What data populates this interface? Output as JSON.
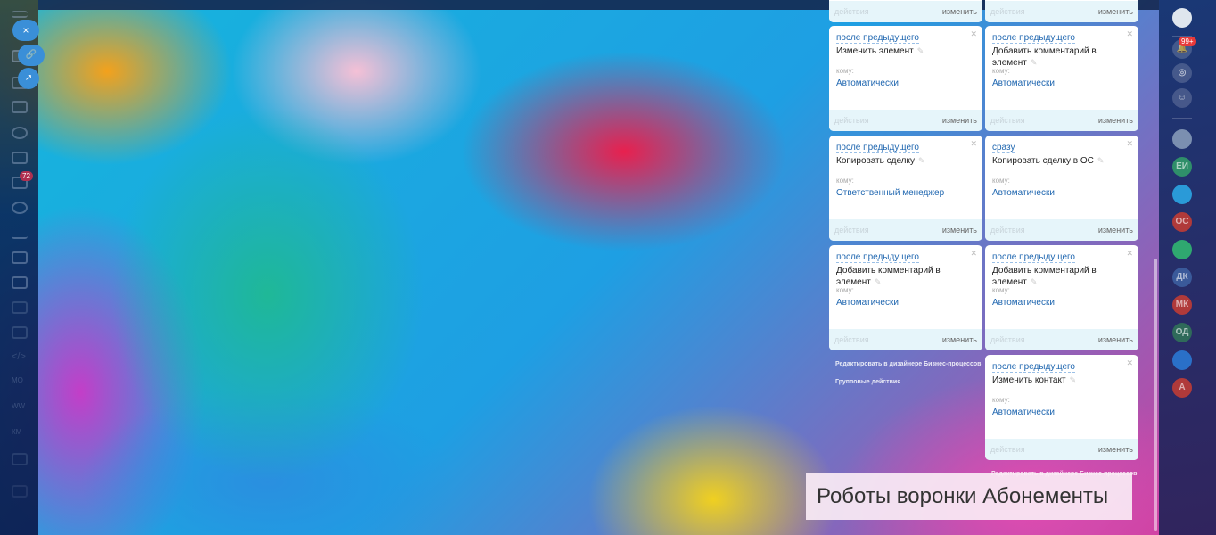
{
  "left_sidebar": {
    "tasks_badge": "72",
    "avatars": [
      "МО",
      "WW",
      "КМ"
    ]
  },
  "slider_buttons": {
    "close": "×",
    "link": "🔗",
    "open": "↗"
  },
  "right_sidebar": {
    "notifications_badge": "99+",
    "avatars": [
      {
        "label": "",
        "color": "#7b8fb0"
      },
      {
        "label": "ЕИ",
        "color": "#2f8f6a"
      },
      {
        "label": "",
        "color": "#2a9ad8"
      },
      {
        "label": "ОС",
        "color": "#b03a3a"
      },
      {
        "label": "",
        "color": "#2fa870"
      },
      {
        "label": "ДК",
        "color": "#3a5a9a"
      },
      {
        "label": "МК",
        "color": "#b03a3a"
      },
      {
        "label": "ОД",
        "color": "#2f6a5a"
      },
      {
        "label": "",
        "color": "#2a70c8"
      },
      {
        "label": "А",
        "color": "#b03a3a"
      }
    ]
  },
  "cards": [
    {
      "col": 0,
      "row": 1,
      "delay": "после предыдущего",
      "title": "Изменить элемент",
      "to": "кому:",
      "who": "Автоматически"
    },
    {
      "col": 1,
      "row": 1,
      "delay": "после предыдущего",
      "title": "Добавить комментарий в элемент",
      "to": "кому:",
      "who": "Автоматически"
    },
    {
      "col": 0,
      "row": 2,
      "delay": "после предыдущего",
      "title": "Копировать сделку",
      "to": "кому:",
      "who": "Ответственный менеджер"
    },
    {
      "col": 1,
      "row": 2,
      "delay": "сразу",
      "title": "Копировать сделку в ОС",
      "to": "кому:",
      "who": "Автоматически"
    },
    {
      "col": 0,
      "row": 3,
      "delay": "после предыдущего",
      "title": "Добавить комментарий в элемент",
      "to": "кому:",
      "who": "Автоматически"
    },
    {
      "col": 1,
      "row": 3,
      "delay": "после предыдущего",
      "title": "Добавить комментарий в элемент",
      "to": "кому:",
      "who": "Автоматически"
    },
    {
      "col": 1,
      "row": 4,
      "delay": "после предыдущего",
      "title": "Изменить контакт",
      "to": "кому:",
      "who": "Автоматически"
    }
  ],
  "card_footer": {
    "actions": "действия",
    "edit": "изменить"
  },
  "column_links": {
    "designer": "Редактировать в дизайнере Бизнес-процессов",
    "group": "Групповые действия"
  },
  "caption": "Роботы воронки Абонементы"
}
